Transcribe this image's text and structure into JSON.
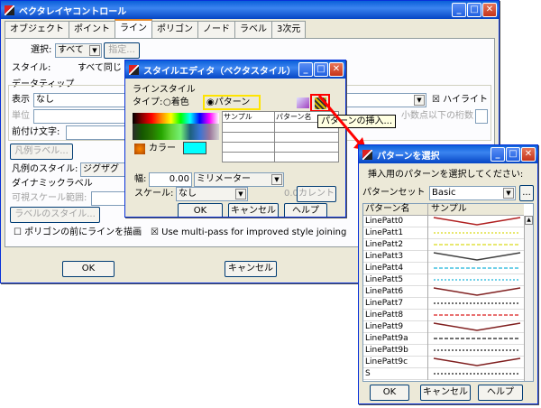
{
  "main": {
    "title": "ベクタレイヤコントロール",
    "tabs": [
      "オブジェクト",
      "ポイント",
      "ライン",
      "ポリゴン",
      "ノード",
      "ラベル",
      "3次元"
    ],
    "select_label": "選択:",
    "select_value": "すべて",
    "specify_button": "指定...",
    "style_label": "スタイル:",
    "style_value": "すべて同じ",
    "datatip_label": "データティップ",
    "display_label": "表示",
    "display_value": "なし",
    "highlight_label": "ハイライト",
    "unit_label": "単位",
    "decimal_label": "小数点以下の桁数",
    "prefix_label": "前付け文字:",
    "legend_label_button": "凡例ラベル...",
    "legend_style_label": "凡例のスタイル:",
    "legend_style_value": "ジグザグ",
    "dynamic_label": "ダイナミックラベル",
    "scale_range_label": "可視スケール範囲:",
    "label_style_button": "ラベルのスタイル...",
    "polygon_front_label": "ポリゴンの前にラインを描画",
    "multipass_label": "Use multi-pass for improved style joining",
    "ok": "OK",
    "cancel": "キャンセル"
  },
  "style_editor": {
    "title": "スタイルエディタ（ベクタスタイル）",
    "line_style_label": "ラインスタイル",
    "type_label": "タイプ:",
    "solid_label": "着色",
    "pattern_label": "パターン",
    "col_sample": "サンプル",
    "col_pattern": "パターン名",
    "color_label": "カラー",
    "width_label": "幅:",
    "width_value": "0.00",
    "width_unit": "ミリメーター",
    "scale_label": "スケール:",
    "scale_value": "なし",
    "scale_num": "0.0",
    "current_button": "カレント",
    "ok": "OK",
    "cancel": "キャンセル",
    "help": "ヘルプ"
  },
  "tooltip": "パターンの挿入...",
  "pattern_dialog": {
    "title": "パターンを選択",
    "prompt": "挿入用のパターンを選択してください:",
    "set_label": "パターンセット",
    "set_value": "Basic",
    "browse": "...",
    "col_name": "パターン名",
    "col_sample": "サンプル",
    "rows": [
      "LinePatt0",
      "LinePatt1",
      "LinePatt2",
      "LinePatt3",
      "LinePatt4",
      "LinePatt5",
      "LinePatt6",
      "LinePatt7",
      "LinePatt8",
      "LinePatt9",
      "LinePatt9a",
      "LinePatt9b",
      "LinePatt9c",
      "S"
    ],
    "row_colors": [
      "#b02020",
      "#e0e040",
      "#e0e040",
      "#404040",
      "#40c0e0",
      "#40c0e0",
      "#802020",
      "#404040",
      "#e04040",
      "#802020",
      "#404040",
      "#404040",
      "#802020",
      "#404040"
    ],
    "ok": "OK",
    "cancel": "キャンセル",
    "help": "ヘルプ"
  },
  "colors": {
    "accent": "#0a5fd9",
    "highlight_red": "#ff0000",
    "cyan": "#00ffff",
    "yellow_box": "#ffff00"
  }
}
